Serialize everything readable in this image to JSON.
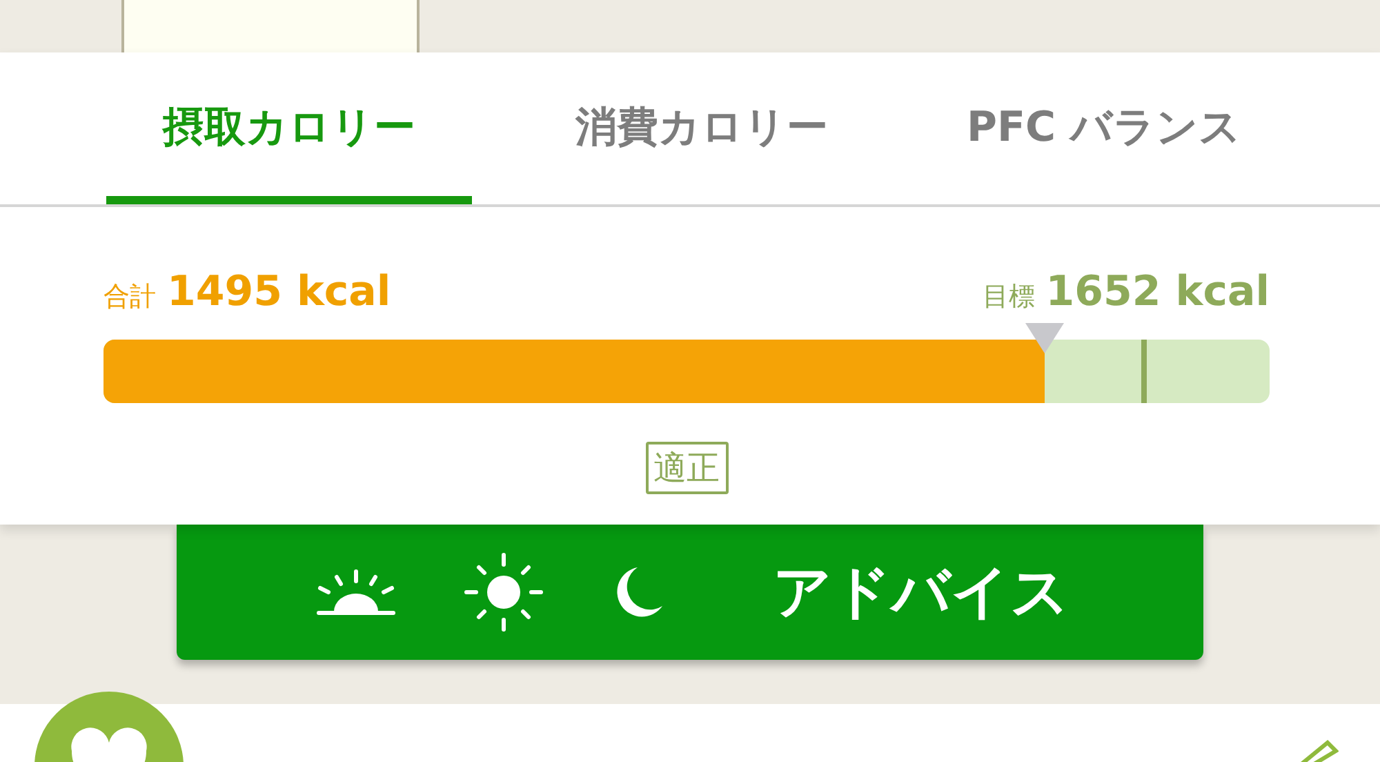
{
  "tabs": [
    {
      "label": "摂取カロリー",
      "selected": true
    },
    {
      "label": "消費カロリー",
      "selected": false
    },
    {
      "label": "PFC バランス",
      "selected": false
    }
  ],
  "summary": {
    "total_label": "合計",
    "total_value": "1495 kcal",
    "goal_label": "目標",
    "goal_value": "1652 kcal",
    "level": 0.807,
    "status": "適正"
  },
  "advice_button": {
    "label": "アドバイス"
  }
}
